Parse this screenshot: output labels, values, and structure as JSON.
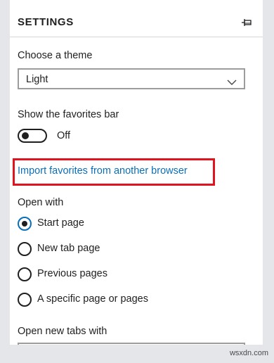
{
  "header": {
    "title": "SETTINGS",
    "pin_icon": "pin-icon"
  },
  "theme": {
    "label": "Choose a theme",
    "selected": "Light",
    "dropdown_icon": "chevron-down-icon"
  },
  "favorites_bar": {
    "label": "Show the favorites bar",
    "state": "Off"
  },
  "import": {
    "link_text": "Import favorites from another browser",
    "highlight_color": "#e0141e"
  },
  "open_with": {
    "label": "Open with",
    "options": [
      "Start page",
      "New tab page",
      "Previous pages",
      "A specific page or pages"
    ],
    "selected": "Start page"
  },
  "new_tabs": {
    "label": "Open new tabs with"
  },
  "watermark": "wsxdn.com",
  "colors": {
    "accent": "#0a6fb8",
    "text": "#1f1f1f",
    "background": "#e4e6ea"
  }
}
